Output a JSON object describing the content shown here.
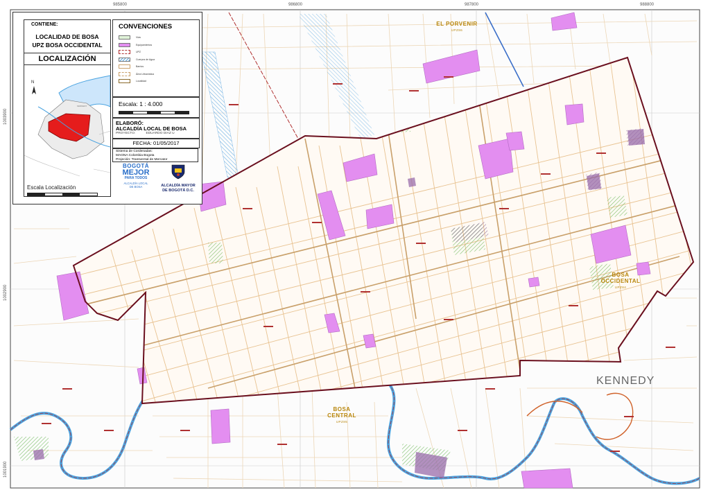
{
  "map": {
    "coordinates": {
      "easting": [
        "985800",
        "986800",
        "987800",
        "988800"
      ],
      "northing": [
        "1003900",
        "1002900",
        "1001900"
      ]
    },
    "upz_labels": [
      {
        "name": "EL PORVENIR",
        "code": "UPZ86"
      },
      {
        "name": "BOSA OCCIDENTAL",
        "code": "UPZ84"
      },
      {
        "name": "BOSA CENTRAL",
        "code": "UPZ85"
      }
    ],
    "locality_label": "KENNEDY"
  },
  "panel": {
    "contiene_label": "CONTIENE:",
    "title_line1": "LOCALIDAD DE BOSA",
    "title_line2": "UPZ BOSA OCCIDENTAL",
    "localizacion_label": "LOCALIZACIÓN",
    "inset_labels": {
      "north": "N",
      "kennedy": "KENNEDY"
    },
    "escala_localizacion_label": "Escala Localización",
    "convenciones": {
      "title": "CONVENCIONES",
      "items": [
        {
          "label": "Vías",
          "swatch": "#dff2d8"
        },
        {
          "label": "Equipamientos",
          "swatch": "#e38ef0"
        },
        {
          "label": "UPZ",
          "swatch": "#ffffff"
        },
        {
          "label": "Cuerpos de Agua",
          "swatch": "#cde6fb"
        },
        {
          "label": "Barrios",
          "swatch": "#ffffff"
        },
        {
          "label": "Área Urbanística",
          "swatch": "#ffffff"
        },
        {
          "label": "Localidad",
          "swatch": "#ffffff"
        }
      ]
    },
    "escala": {
      "label": "Escala:",
      "value": "1 : 4.000"
    },
    "elaboro": {
      "label": "ELABORÓ:",
      "org": "ALCALDÍA LOCAL DE BOSA",
      "proyecto_label": "PROYECTO:",
      "proyecto_value": "EDUARDO DIAZ U"
    },
    "fecha": {
      "label": "FECHA:",
      "value": "01/05/2017"
    },
    "sistema": {
      "line1": "Sistema de Cordenadas:",
      "line2": "MAGNA Colombia Bogota",
      "line3": "Projeción: Transversal de Mercator"
    },
    "logos": {
      "bogota": {
        "line1": "BOGOTÁ",
        "line2": "MEJOR",
        "line3": "PARA TODOS",
        "line4": "ALCALDÍA LOCAL",
        "line5": "DE BOSA"
      },
      "alcaldia": {
        "line1": "ALCALDÍA MAYOR",
        "line2": "DE BOGOTÁ D.C."
      }
    }
  },
  "colors": {
    "equipamiento": "#e38ef0",
    "upz_border": "#6a0f1e",
    "locality_border": "#c0392b",
    "river": "#4aa3e0",
    "street": "#e8c290",
    "green": "#9bd37f",
    "gold_text": "#b8860b"
  }
}
